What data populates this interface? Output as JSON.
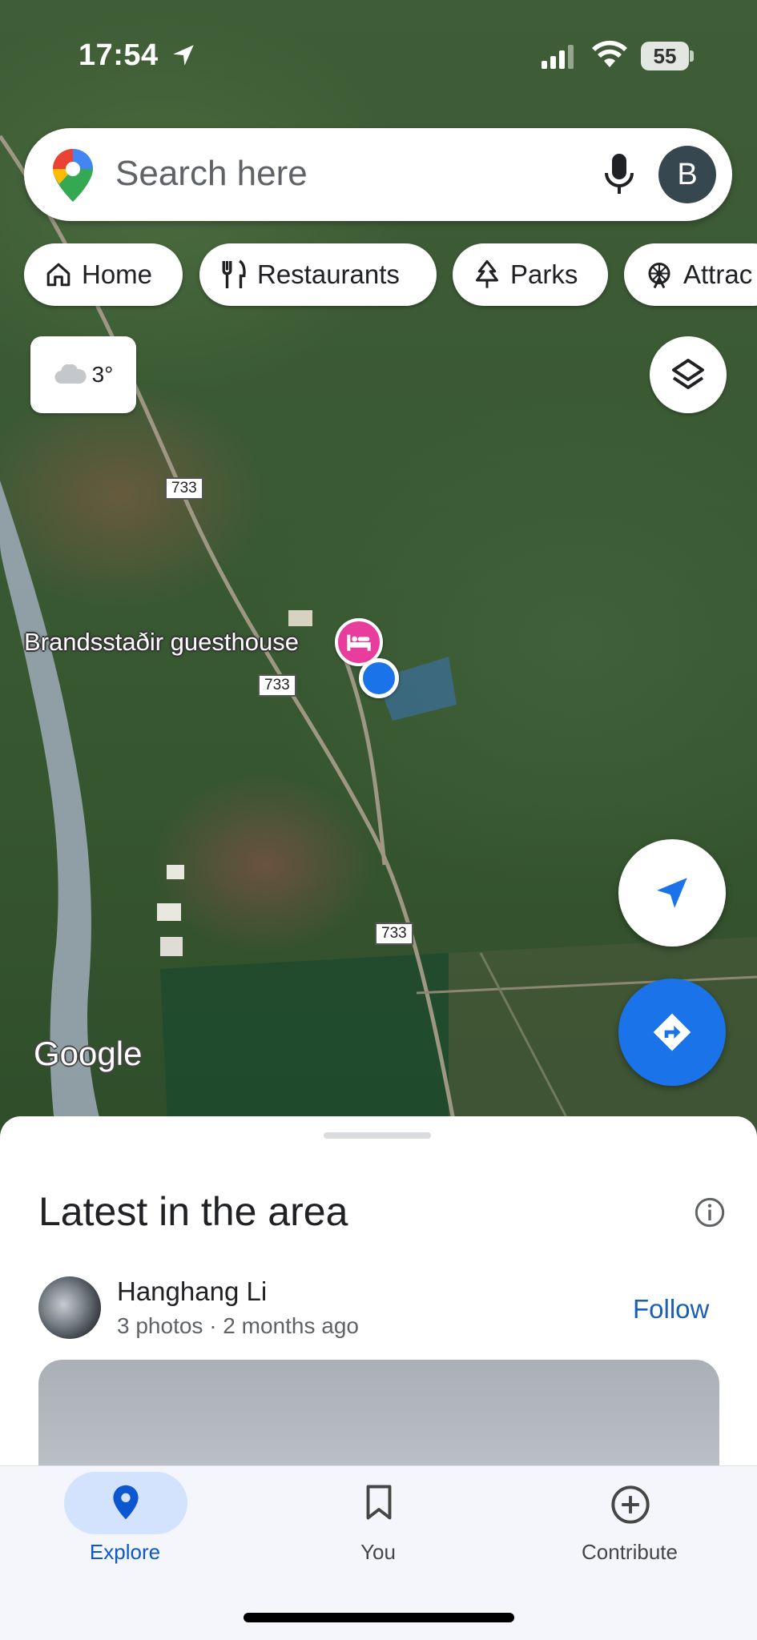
{
  "status_bar": {
    "time": "17:54",
    "battery": "55"
  },
  "search": {
    "placeholder": "Search here",
    "avatar_letter": "B"
  },
  "chips": [
    {
      "label": "Home",
      "icon": "home-icon"
    },
    {
      "label": "Restaurants",
      "icon": "fork-knife-icon"
    },
    {
      "label": "Parks",
      "icon": "tree-icon"
    },
    {
      "label": "Attrac",
      "icon": "ferris-wheel-icon"
    }
  ],
  "weather": {
    "temperature": "3°",
    "icon": "cloud-icon"
  },
  "map": {
    "route_labels": [
      "733",
      "733",
      "733"
    ],
    "place_name": "Brandsstaðir guesthouse",
    "attribution": "Google"
  },
  "sheet": {
    "title": "Latest in the area",
    "post": {
      "author": "Hanghang Li",
      "meta": "3 photos · 2 months ago",
      "follow_label": "Follow"
    }
  },
  "nav": {
    "items": [
      {
        "label": "Explore",
        "icon": "location-pin-icon",
        "active": true
      },
      {
        "label": "You",
        "icon": "bookmark-icon",
        "active": false
      },
      {
        "label": "Contribute",
        "icon": "add-circle-icon",
        "active": false
      }
    ]
  },
  "colors": {
    "accent": "#1a73e8",
    "hotel_pin": "#e83d9c",
    "active_pill": "#d3e3fd"
  }
}
